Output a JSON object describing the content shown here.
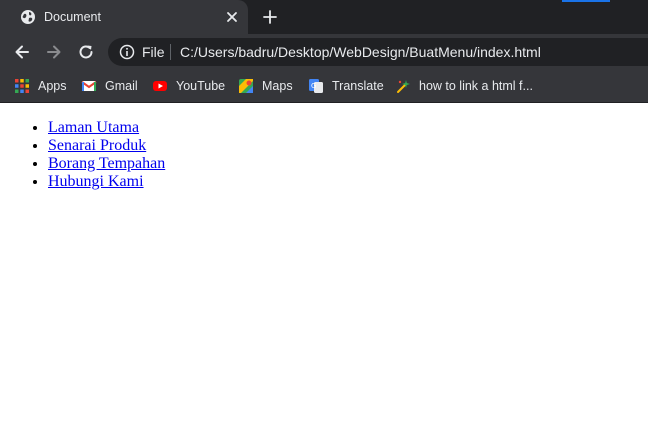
{
  "browser": {
    "tab": {
      "title": "Document",
      "favicon": "globe-icon",
      "close_icon": "close-icon"
    },
    "new_tab_icon": "plus-icon",
    "nav": {
      "back_icon": "back-arrow-icon",
      "forward_icon": "forward-arrow-icon",
      "reload_icon": "reload-icon"
    },
    "omnibox": {
      "scheme_label": "File",
      "url": "C:/Users/badru/Desktop/WebDesign/BuatMenu/index.html",
      "info_icon": "info-icon"
    },
    "bookmarks": [
      {
        "label": "Apps",
        "icon": "apps-grid-icon"
      },
      {
        "label": "Gmail",
        "icon": "gmail-icon"
      },
      {
        "label": "YouTube",
        "icon": "youtube-icon"
      },
      {
        "label": "Maps",
        "icon": "maps-icon"
      },
      {
        "label": "Translate",
        "icon": "translate-icon"
      },
      {
        "label": "how to link a html f...",
        "icon": "sparkle-icon"
      }
    ]
  },
  "page": {
    "menu_items": [
      {
        "label": "Laman Utama"
      },
      {
        "label": "Senarai Produk"
      },
      {
        "label": "Borang Tempahan"
      },
      {
        "label": "Hubungi Kami"
      }
    ]
  },
  "colors": {
    "chrome_dark": "#202124",
    "chrome_toolbar": "#35363a",
    "chrome_text": "#e8eaed",
    "link": "#0000ee",
    "accent": "#1a73e8"
  }
}
